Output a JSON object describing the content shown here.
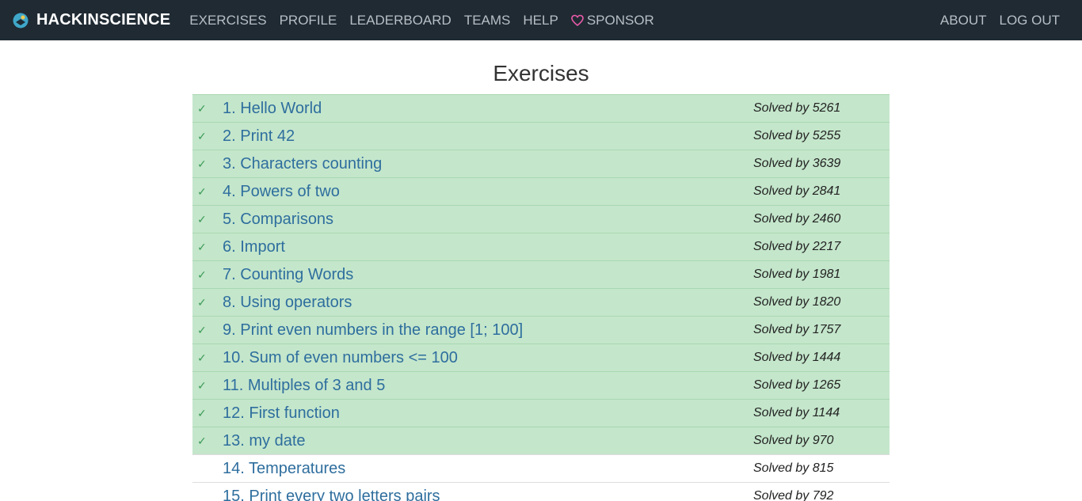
{
  "nav": {
    "brand": "HACKINSCIENCE",
    "links": [
      "EXERCISES",
      "PROFILE",
      "LEADERBOARD",
      "TEAMS",
      "HELP"
    ],
    "sponsor": "SPONSOR",
    "right_links": [
      "ABOUT",
      "LOG OUT"
    ]
  },
  "page": {
    "title": "Exercises"
  },
  "exercises": [
    {
      "title": "1. Hello World",
      "solved_by": "Solved by 5261",
      "done": true,
      "check": "✓"
    },
    {
      "title": "2. Print 42",
      "solved_by": "Solved by 5255",
      "done": true,
      "check": "✓"
    },
    {
      "title": "3. Characters counting",
      "solved_by": "Solved by 3639",
      "done": true,
      "check": "✓"
    },
    {
      "title": "4. Powers of two",
      "solved_by": "Solved by 2841",
      "done": true,
      "check": "✓"
    },
    {
      "title": "5. Comparisons",
      "solved_by": "Solved by 2460",
      "done": true,
      "check": "✓"
    },
    {
      "title": "6. Import",
      "solved_by": "Solved by 2217",
      "done": true,
      "check": "✓"
    },
    {
      "title": "7. Counting Words",
      "solved_by": "Solved by 1981",
      "done": true,
      "check": "✓"
    },
    {
      "title": "8. Using operators",
      "solved_by": "Solved by 1820",
      "done": true,
      "check": "✓"
    },
    {
      "title": "9. Print even numbers in the range [1; 100]",
      "solved_by": "Solved by 1757",
      "done": true,
      "check": "✓"
    },
    {
      "title": "10. Sum of even numbers <= 100",
      "solved_by": "Solved by 1444",
      "done": true,
      "check": "✓"
    },
    {
      "title": "11. Multiples of 3 and 5",
      "solved_by": "Solved by 1265",
      "done": true,
      "check": "✓"
    },
    {
      "title": "12. First function",
      "solved_by": "Solved by 1144",
      "done": true,
      "check": "✓"
    },
    {
      "title": "13. my date",
      "solved_by": "Solved by 970",
      "done": true,
      "check": "✓"
    },
    {
      "title": "14. Temperatures",
      "solved_by": "Solved by 815",
      "done": false,
      "check": ""
    },
    {
      "title": "15. Print every two letters pairs",
      "solved_by": "Solved by 792",
      "done": false,
      "check": ""
    }
  ]
}
